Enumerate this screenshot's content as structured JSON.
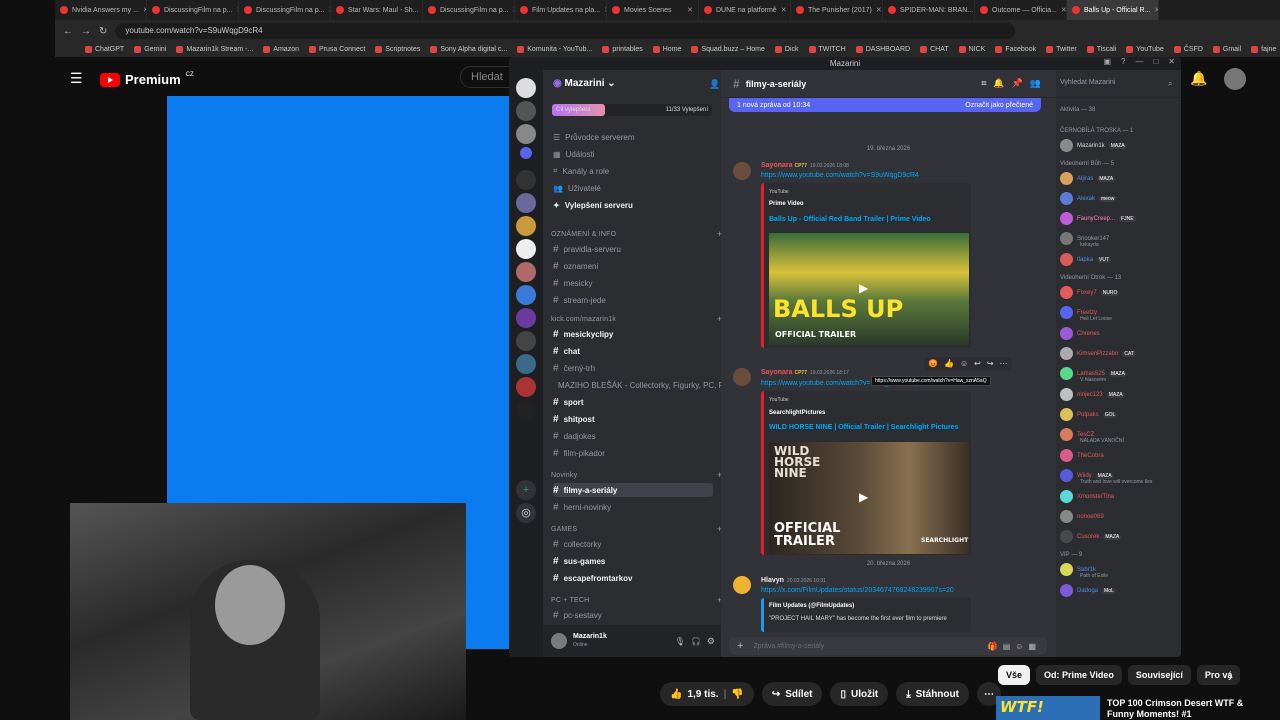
{
  "browser": {
    "tabs": [
      {
        "label": "Nvidia Answers my ..."
      },
      {
        "label": "DiscussingFilm na p..."
      },
      {
        "label": "DiscussingFilm na p..."
      },
      {
        "label": "Star Wars: Maul - Sh..."
      },
      {
        "label": "DiscussingFilm na p..."
      },
      {
        "label": "Film Updates na pla..."
      },
      {
        "label": "Movies Scenes"
      },
      {
        "label": "DUNE na platformě"
      },
      {
        "label": "The Punisher (2017)"
      },
      {
        "label": "SPIDER-MAN: BRAN..."
      },
      {
        "label": "Outcome — Officia..."
      },
      {
        "label": "Balls Up - Official R..."
      }
    ],
    "url": "youtube.com/watch?v=S9uWqgD9cR4",
    "bookmarks": [
      "ChatGPT",
      "Gemini",
      "Mazarin1k Stream -...",
      "Amazon",
      "Prusa Connect",
      "Scriptnotes",
      "Sony Alpha digital c...",
      "Komunita - YouTub...",
      "printables",
      "Home",
      "Squad.buzz – Home",
      "Dick",
      "TWITCH",
      "DASHBOARD",
      "CHAT",
      "NICK",
      "Facebook",
      "Twitter",
      "Tiscali",
      "YouTube",
      "ČSFD",
      "Gmail",
      "fajne"
    ],
    "bookmarks_other": "Všechny záložky"
  },
  "youtube": {
    "logo": "Premium",
    "logo_region": "CZ",
    "search_placeholder": "Hledat",
    "likes": "1,9 tis.",
    "share": "Sdílet",
    "save": "Uložit",
    "download": "Stáhnout",
    "chips": [
      "Vše",
      "Od: Prime Video",
      "Související",
      "Pro vá"
    ],
    "rec_title": "TOP 100 Crimson Desert WTF & Funny Moments! #1",
    "rec_thumb_text": "WTF!"
  },
  "discord": {
    "window_title": "Mazarini",
    "server_name": "Mazarini",
    "boost": {
      "label": "Cíl vylepšení",
      "count": "11/33 Vylepšení",
      "progress": 0.33
    },
    "nav": [
      "Průvodce serverem",
      "Události",
      "Kanály a role",
      "Uživatelé",
      "Vylepšení serveru"
    ],
    "categories": {
      "info": "OZNÁMENÍ & INFO",
      "kick": "kick.com/mazarin1k",
      "novinky": "Novinky",
      "games": "GAMES",
      "pctech": "PC + TECH"
    },
    "channels_info": [
      "pravidla-serveru",
      "oznameni",
      "mesicky",
      "stream-jede"
    ],
    "channels_kick": [
      "mesickyclipy",
      "chat",
      "černý-trh",
      "MAZIHO BLEŠÁK - Collectorky, Figurky, PC, FO...",
      "sport",
      "shitpost",
      "dadjokes",
      "film-pikador"
    ],
    "channels_novinky": [
      "filmy-a-seriály",
      "herni-novinky"
    ],
    "channels_games": [
      "collectorky",
      "sus-games",
      "escapefromtarkov"
    ],
    "channels_pctech": [
      "pc-sestavy"
    ],
    "user": {
      "name": "Mazarin1k",
      "status": "Online"
    },
    "chat": {
      "channel": "filmy-a-seriály",
      "new_msg": "1 nová zpráva od 10:34",
      "mark_read": "Označit jako přečtené",
      "date1": "19. března 2026",
      "date2": "20. března 2026",
      "msg1": {
        "author": "Sayonara",
        "badge": "CP77",
        "time": "19.03.2026 18:08",
        "link": "https://www.youtube.com/watch?v=S9uWqgD9cR4",
        "provider": "YouTube",
        "embed_author": "Prime Video",
        "embed_title": "Balls Up - Official Red Band Trailer | Prime Video",
        "thumb_big": "BALLS UP",
        "thumb_small": "OFFICIAL TRAILER"
      },
      "msg2": {
        "author": "Sayonara",
        "badge": "CP77",
        "time": "19.03.2026 18:17",
        "link": "https://www.youtube.com/watch?v=Haw_sznA5aQ",
        "tooltip": "https://www.youtube.com/watch?v=Haw_sznA5aQ",
        "provider": "YouTube",
        "embed_author": "SearchlightPictures",
        "embed_title": "WILD HORSE NINE | Official Trailer | Searchlight Pictures",
        "thumb_big": "WILD HORSE NINE",
        "thumb_small": "OFFICIAL TRAILER",
        "thumb_brand": "SEARCHLIGHT"
      },
      "msg3": {
        "author": "Hlavyn",
        "time": "20.03.2026 10:31",
        "link": "https://x.com/FilmUpdates/status/2034674768248239907s=20",
        "embed_author": "Film Updates (@FilmUpdates)",
        "embed_text": "\"PROJECT HAIL MARY\" has become the first ever film to premiere"
      },
      "composer_placeholder": "Zpráva #filmy-a-seriály"
    },
    "members": {
      "search_placeholder": "Vyhledat Mazarini",
      "activity": "Aktivita — 38",
      "groups": [
        {
          "title": "ČERNOBÍLÁ TROSKA — 1",
          "members": [
            {
              "name": "Mazarin1k",
              "tag": "MAZA",
              "color": "#dbdee1"
            }
          ]
        },
        {
          "title": "Videoherní Bůh — 5",
          "members": [
            {
              "name": "Aljiras",
              "tag": "MAZA",
              "color": "#4e90e6"
            },
            {
              "name": "Alexak",
              "tag": "meow",
              "color": "#4e90e6"
            },
            {
              "name": "FaunyCreep...",
              "tag": "FJNE",
              "color": "#ff82c0"
            },
            {
              "name": "Snooker147",
              "sub": "kekayda",
              "color": "#949ba4"
            },
            {
              "name": "tlapka",
              "tag": "VUT",
              "color": "#4e90e6"
            }
          ]
        },
        {
          "title": "Videoherní Otrok — 13",
          "members": [
            {
              "name": "Foxey7",
              "tag": "NURO",
              "color": "#e35b5b"
            },
            {
              "name": "Freetzy",
              "sub": "Hell Let Loose",
              "color": "#e35b5b"
            },
            {
              "name": "Chrenes",
              "color": "#e35b5b"
            },
            {
              "name": "KimsenPizzabo",
              "tag": "CAT",
              "color": "#e35b5b"
            },
            {
              "name": "Lamas525",
              "tag": "MAZA",
              "sub": "V hlasovém",
              "color": "#e35b5b"
            },
            {
              "name": "ninjec123",
              "tag": "MAZA",
              "color": "#e35b5b"
            },
            {
              "name": "Pufpaks",
              "tag": "GOL",
              "color": "#e35b5b"
            },
            {
              "name": "TesCZ",
              "sub": "NÁLADA VÁNOČNÍ",
              "color": "#e35b5b"
            },
            {
              "name": "TheCobra",
              "color": "#e35b5b"
            },
            {
              "name": "Wiidy",
              "tag": "MAZA",
              "sub": "Truth and love will overcome lies",
              "color": "#e35b5b"
            },
            {
              "name": "XmonsterTina",
              "color": "#e35b5b"
            },
            {
              "name": "nonoe069",
              "color": "#e35b5b"
            },
            {
              "name": "Cusorek",
              "tag": "MAZA",
              "color": "#e35b5b"
            }
          ]
        },
        {
          "title": "VIP — 9",
          "members": [
            {
              "name": "Sabr1k",
              "sub": "Path of Exile",
              "color": "#4e90e6"
            },
            {
              "name": "Dadoga",
              "tag": "MoL",
              "color": "#4e90e6"
            }
          ]
        }
      ]
    }
  }
}
